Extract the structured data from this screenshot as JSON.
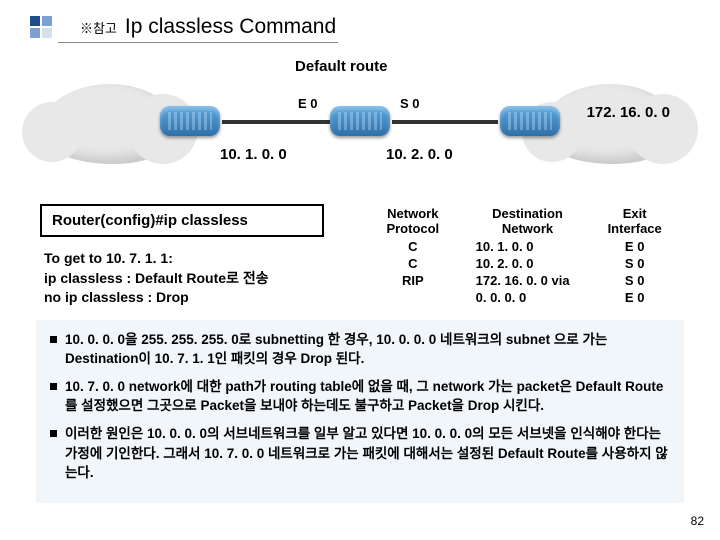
{
  "header": {
    "ref": "※참고",
    "title": "Ip classless Command"
  },
  "diagram": {
    "default_route": "Default route",
    "e0": "E 0",
    "s0": "S 0",
    "net_left": "10. 1. 0. 0",
    "net_mid": "10. 2. 0. 0",
    "net_right": "172. 16. 0. 0"
  },
  "cmd": "Router(config)#ip  classless",
  "explain": {
    "line1": "To get to 10. 7. 1. 1:",
    "line2": "ip classless : Default Route로 전송",
    "line3": "no ip classless : Drop"
  },
  "table": {
    "headers": {
      "proto": "Network Protocol",
      "dest": "Destination Network",
      "exit": "Exit Interface"
    },
    "rows": [
      {
        "proto": "C",
        "dest": "10. 1. 0. 0",
        "exit": "E 0"
      },
      {
        "proto": "C",
        "dest": "10. 2. 0. 0",
        "exit": "S 0"
      },
      {
        "proto": "RIP",
        "dest": "172. 16. 0. 0 via",
        "exit": "S 0"
      },
      {
        "proto": "",
        "dest": "0. 0. 0. 0",
        "exit": "E 0"
      }
    ]
  },
  "notes": [
    "10. 0. 0. 0을 255. 255. 255. 0로 subnetting 한 경우, 10. 0. 0. 0 네트워크의 subnet 으로 가는 Destination이 10. 7. 1. 1인 패킷의 경우 Drop 된다.",
    "10. 7. 0. 0  network에 대한 path가 routing table에 없을 때, 그 network 가는 packet은  Default Route를 설정했으면  그곳으로 Packet을 보내야 하는데도 불구하고 Packet을  Drop 시킨다.",
    "이러한 원인은 10. 0. 0. 0의 서브네트워크를 일부 알고 있다면 10. 0. 0. 0의 모든 서브넷을 인식해야 한다는 가정에 기인한다.  그래서 10. 7. 0. 0 네트워크로 가는 패킷에 대해서는 설정된  Default Route를 사용하지 않는다."
  ],
  "page": "82"
}
